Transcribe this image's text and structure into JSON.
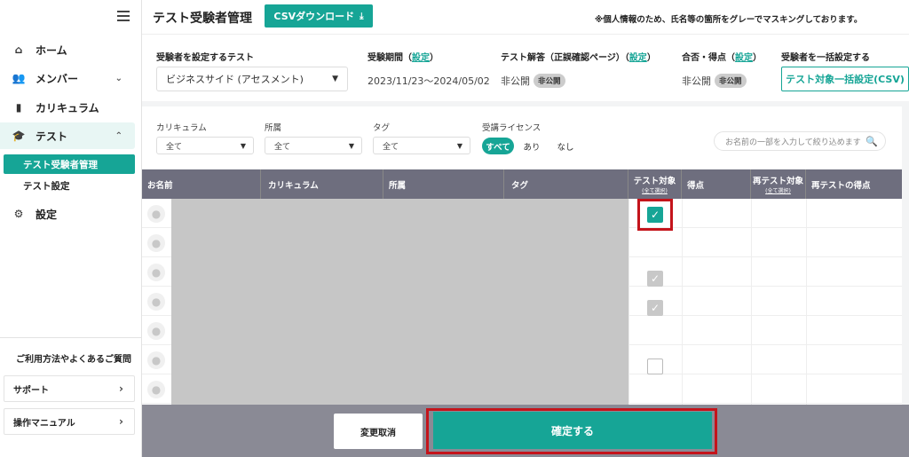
{
  "sidebar": {
    "items": [
      {
        "label": "ホーム"
      },
      {
        "label": "メンバー"
      },
      {
        "label": "カリキュラム"
      },
      {
        "label": "テスト"
      },
      {
        "label": "設定"
      }
    ],
    "sub_items": [
      {
        "label": "テスト受験者管理"
      },
      {
        "label": "テスト設定"
      }
    ],
    "help_title": "ご利用方法やよくあるご質問",
    "support_label": "サポート",
    "manual_label": "操作マニュアル"
  },
  "header": {
    "title": "テスト受験者管理",
    "csv_button": "CSVダウンロード",
    "notice": "※個人情報のため、氏名等の箇所をグレーでマスキングしております。"
  },
  "settings": {
    "test_label": "受験者を設定するテスト",
    "test_value": "ビジネスサイド (アセスメント)",
    "period_label": "受験期間",
    "period_link": "設定",
    "period_value": "2023/11/23～2024/05/02",
    "answer_label": "テスト解答（正誤確認ページ）",
    "answer_link": "設定",
    "answer_value": "非公開",
    "answer_badge": "非公開",
    "pass_label": "合否・得点",
    "pass_link": "設定",
    "pass_value": "非公開",
    "pass_badge": "非公開",
    "bulk_label": "受験者を一括設定する",
    "bulk_button": "テスト対象一括設定(CSV)"
  },
  "filters": {
    "curriculum_label": "カリキュラム",
    "curriculum_value": "全て",
    "dept_label": "所属",
    "dept_value": "全て",
    "tag_label": "タグ",
    "tag_value": "全て",
    "license_label": "受講ライセンス",
    "license_options": [
      "すべて",
      "あり",
      "なし"
    ],
    "search_placeholder": "お名前の一部を入力して絞り込めます"
  },
  "table": {
    "headers": {
      "name": "お名前",
      "curriculum": "カリキュラム",
      "dept": "所属",
      "tag": "タグ",
      "target": "テスト対象",
      "target_sub": "(全て選択)",
      "score": "得点",
      "retest": "再テスト対象",
      "retest_sub": "(全て選択)",
      "retest_score": "再テストの得点"
    },
    "rows": [
      {
        "checkbox": "checked"
      },
      {
        "checkbox": "none"
      },
      {
        "checkbox": "disabled"
      },
      {
        "checkbox": "disabled"
      },
      {
        "checkbox": "none"
      },
      {
        "checkbox": "unchecked"
      },
      {
        "checkbox": "none"
      }
    ]
  },
  "footer": {
    "cancel_button": "変更取消",
    "confirm_button": "確定する"
  },
  "colors": {
    "accent": "#16a596",
    "highlight": "#c4141b"
  }
}
